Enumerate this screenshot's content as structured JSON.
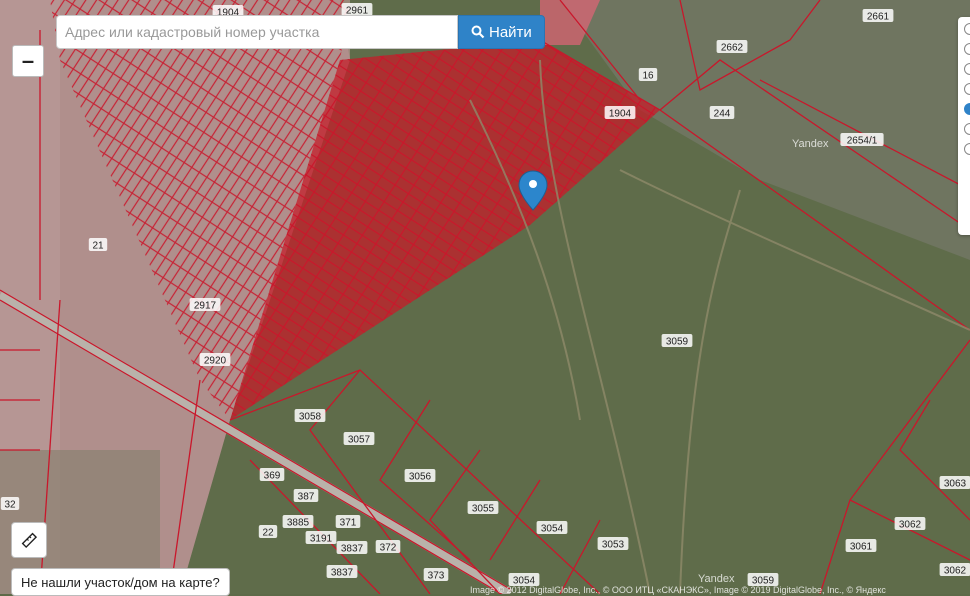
{
  "search": {
    "placeholder": "Адрес или кадастровый номер участка",
    "button_label": "Найти"
  },
  "controls": {
    "zoom_out_label": "–",
    "not_found_label": "Не нашли участок/дом на карте?"
  },
  "attribution": "Image © 2012 DigitalGlobe, Inc., © ООО ИТЦ «СКАНЭКС», Image © 2019 DigitalGlobe, Inc., © Яндекс",
  "watermarks": [
    "Yandex",
    "Yandex"
  ],
  "layer_panel": {
    "selected_index": 4,
    "option_count": 7
  },
  "parcel_labels": [
    "1904",
    "2961",
    "2661",
    "2662",
    "16",
    "1904",
    "244",
    "2654/1",
    "21",
    "2917",
    "2920",
    "3058",
    "3059",
    "3057",
    "3056",
    "369",
    "387",
    "3055",
    "3054",
    "3063",
    "3062",
    "371",
    "3885",
    "3191",
    "22",
    "3837",
    "372",
    "3053",
    "3061",
    "3837",
    "373",
    "3054",
    "3059",
    "32",
    "3062"
  ],
  "colors": {
    "parcel_border": "#c9172b",
    "selected_fill": "#c41e2a",
    "accent": "#2f83c8"
  }
}
